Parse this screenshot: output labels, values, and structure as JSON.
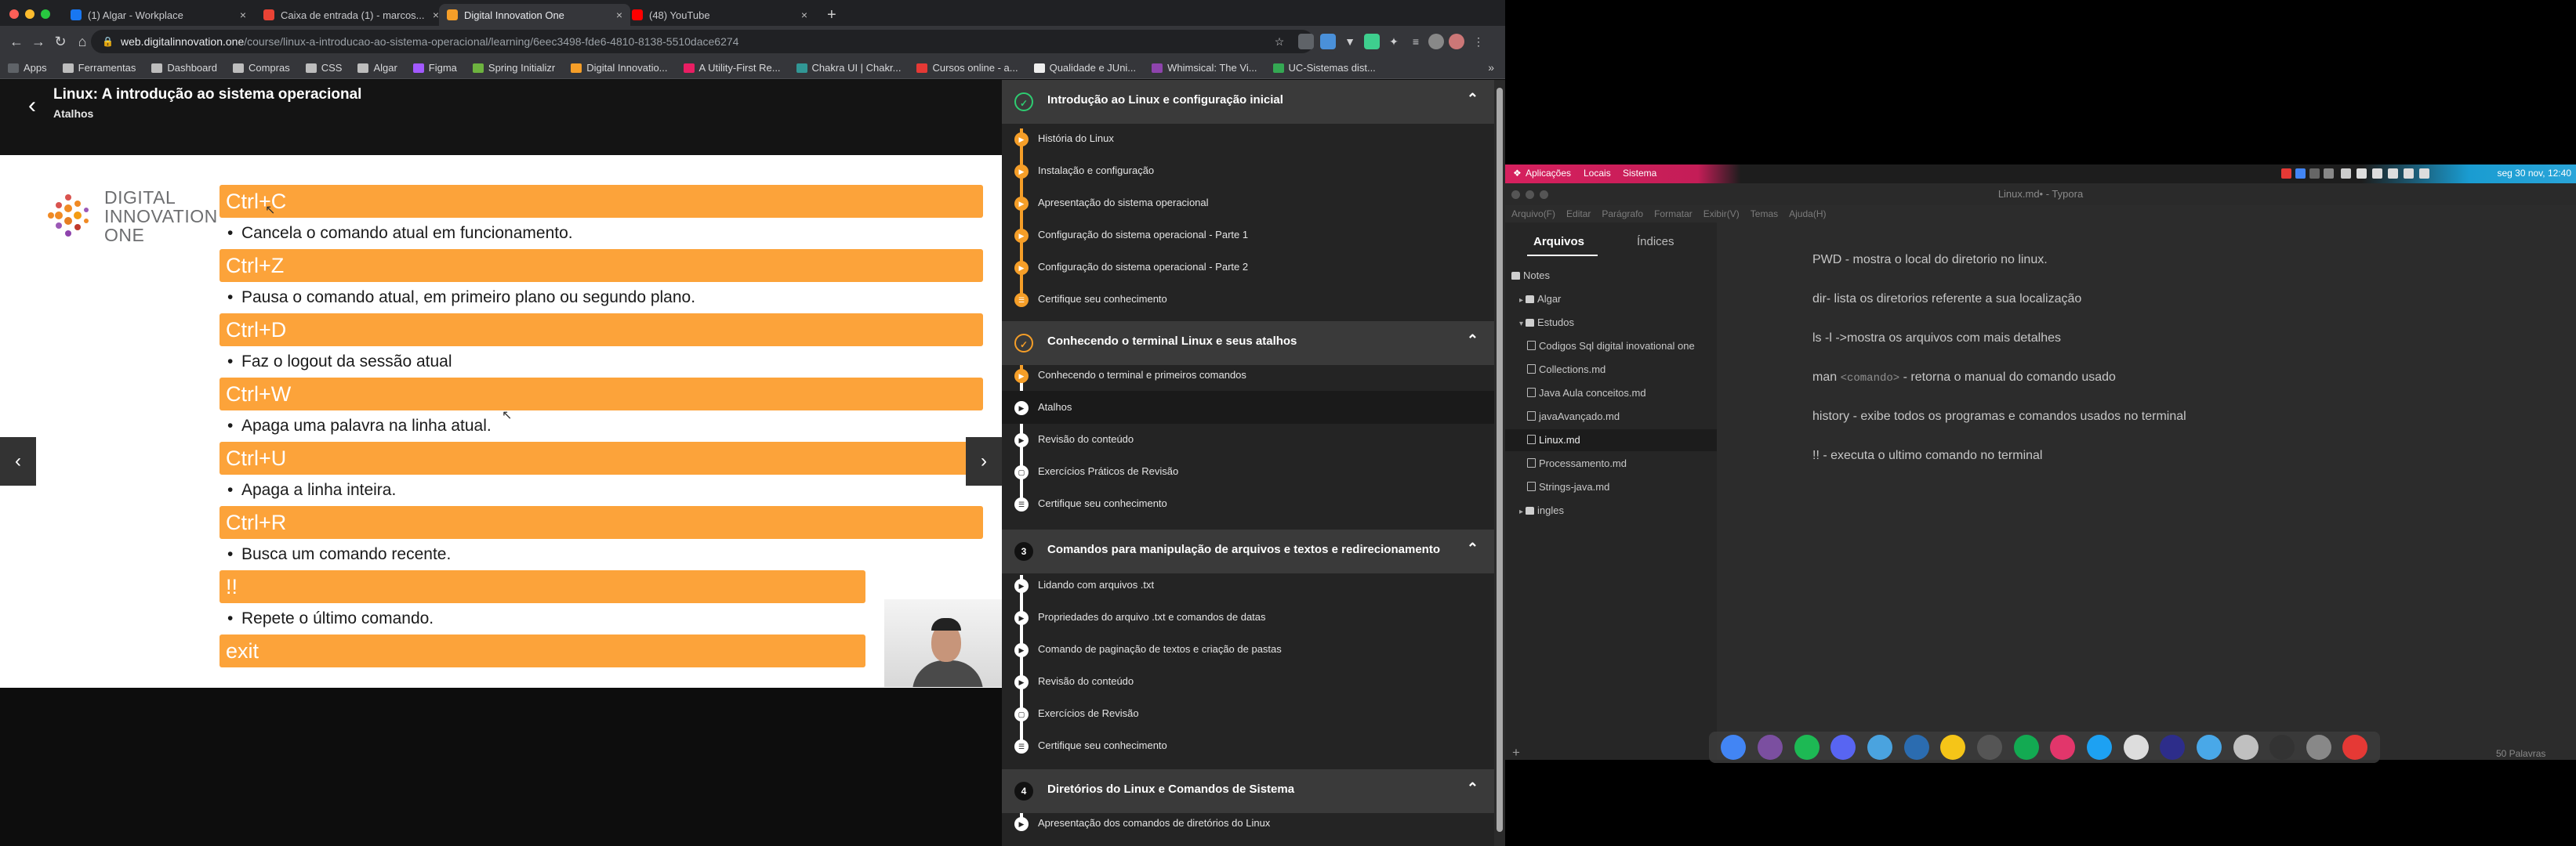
{
  "browser": {
    "tabs": [
      {
        "title": "(1) Algar - Workplace",
        "color": "#1877f2",
        "active": false
      },
      {
        "title": "Caixa de entrada (1) - marcos...",
        "color": "#ea4335",
        "active": false
      },
      {
        "title": "Digital Innovation One",
        "color": "#f59e28",
        "active": true
      },
      {
        "title": "(48) YouTube",
        "color": "#ff0000",
        "active": false
      }
    ],
    "url_host": "web.digitalinnovation.one",
    "url_path": "/course/linux-a-introducao-ao-sistema-operacional/learning/6eec3498-fde6-4810-8138-5510dace6274",
    "bookmarks": [
      "Apps",
      "Ferramentas",
      "Dashboard",
      "Compras",
      "CSS",
      "Algar",
      "Figma",
      "Spring Initializr",
      "Digital Innovatio...",
      "A Utility-First Re...",
      "Chakra UI | Chakr...",
      "Cursos online - a...",
      "Qualidade e JUni...",
      "Whimsical: The Vi...",
      "UC-Sistemas dist..."
    ]
  },
  "course": {
    "title": "Linux: A introdução ao sistema operacional",
    "lesson": "Atalhos"
  },
  "slide": {
    "logo_lines": [
      "DIGITAL",
      "INNOVATION",
      "ONE"
    ],
    "shortcuts": [
      {
        "key": "Ctrl+C",
        "desc": "Cancela o comando atual em funcionamento."
      },
      {
        "key": "Ctrl+Z",
        "desc": "Pausa o comando atual, em primeiro plano ou  segundo plano."
      },
      {
        "key": "Ctrl+D",
        "desc": "Faz o logout da sessão atual"
      },
      {
        "key": "Ctrl+W",
        "desc": "Apaga uma palavra na linha atual."
      },
      {
        "key": "Ctrl+U",
        "desc": "Apaga a linha inteira."
      },
      {
        "key": "Ctrl+R",
        "desc": "Busca um comando recente."
      },
      {
        "key": "!!",
        "desc": "Repete o último comando."
      },
      {
        "key": "exit",
        "desc": ""
      }
    ],
    "prev_icon": "chevron-left-icon",
    "next_icon": "chevron-right-icon"
  },
  "sidebar": {
    "sections": [
      {
        "badge": "✓",
        "title": "Introdução ao Linux e configuração inicial",
        "lessons": [
          "História do Linux",
          "Instalação e configuração",
          "Apresentação do sistema operacional",
          "Configuração do sistema operacional - Parte 1",
          "Configuração do sistema operacional - Parte 2",
          "Certifique seu conhecimento"
        ]
      },
      {
        "badge": "✓",
        "title": "Conhecendo o terminal Linux e seus atalhos",
        "lessons": [
          "Conhecendo o terminal e primeiros comandos",
          "Atalhos",
          "Revisão do conteúdo",
          "Exercícios Práticos de Revisão",
          "Certifique seu conhecimento"
        ]
      },
      {
        "badge": "3",
        "title": "Comandos para manipulação de arquivos e textos e redirecionamento",
        "lessons": [
          "Lidando com arquivos .txt",
          "Propriedades do arquivo .txt e comandos de datas",
          "Comando de paginação de textos e criação de pastas",
          "Revisão do conteúdo",
          "Exercícios de Revisão",
          "Certifique seu conhecimento"
        ]
      },
      {
        "badge": "4",
        "title": "Diretórios do Linux e Comandos de Sistema",
        "lessons": [
          "Apresentação dos comandos de diretórios do Linux"
        ]
      }
    ]
  },
  "desktop": {
    "topbar": {
      "menus": [
        "Aplicações",
        "Locais",
        "Sistema"
      ],
      "clock": "seg 30 nov, 12:40"
    },
    "typora": {
      "window_title": "Linux.md• - Typora",
      "menu": [
        "Arquivo(F)",
        "Editar",
        "Parágrafo",
        "Formatar",
        "Exibir(V)",
        "Temas",
        "Ajuda(H)"
      ],
      "tabs": [
        "Arquivos",
        "Índices"
      ],
      "tree": [
        {
          "label": "Notes",
          "type": "folder",
          "level": 0,
          "arrow": ""
        },
        {
          "label": "Algar",
          "type": "folder",
          "level": 1,
          "arrow": "▸"
        },
        {
          "label": "Estudos",
          "type": "folder",
          "level": 1,
          "arrow": "▾"
        },
        {
          "label": "Codigos Sql digital inovational one",
          "type": "doc",
          "level": 2,
          "arrow": ""
        },
        {
          "label": "Collections.md",
          "type": "doc",
          "level": 2,
          "arrow": ""
        },
        {
          "label": "Java Aula conceitos.md",
          "type": "doc",
          "level": 2,
          "arrow": ""
        },
        {
          "label": "javaAvançado.md",
          "type": "doc",
          "level": 2,
          "arrow": ""
        },
        {
          "label": "Linux.md",
          "type": "doc",
          "level": 2,
          "arrow": "",
          "selected": true
        },
        {
          "label": "Processamento.md",
          "type": "doc",
          "level": 2,
          "arrow": ""
        },
        {
          "label": "Strings-java.md",
          "type": "doc",
          "level": 2,
          "arrow": ""
        },
        {
          "label": "ingles",
          "type": "folder",
          "level": 1,
          "arrow": "▸"
        }
      ],
      "lines": [
        {
          "pre": "PWD - mostra o local do diretorio no linux.",
          "code": "",
          "post": ""
        },
        {
          "pre": "dir- lista os diretorios referente a sua localização",
          "code": "",
          "post": ""
        },
        {
          "pre": "ls -l  ->mostra os arquivos com mais detalhes",
          "code": "",
          "post": ""
        },
        {
          "pre": "man ",
          "code": "<comando>",
          "post": " - retorna o manual do comando usado"
        },
        {
          "pre": "history - exibe todos os programas e comandos usados no terminal",
          "code": "",
          "post": ""
        },
        {
          "pre": "!! - executa o ultimo comando no terminal",
          "code": "",
          "post": ""
        }
      ],
      "word_count": "50 Palavras"
    },
    "dock_colors": [
      "#4285f4",
      "#7b4fa0",
      "#1db954",
      "#5865f2",
      "#4aa3df",
      "#2b6cb0",
      "#f5c518",
      "#555555",
      "#13aa52",
      "#e2366b",
      "#1da1f2",
      "#dddddd",
      "#2d2d8a",
      "#49a8e8",
      "#c0c0c0",
      "#333333",
      "#888888",
      "#e53935"
    ]
  }
}
